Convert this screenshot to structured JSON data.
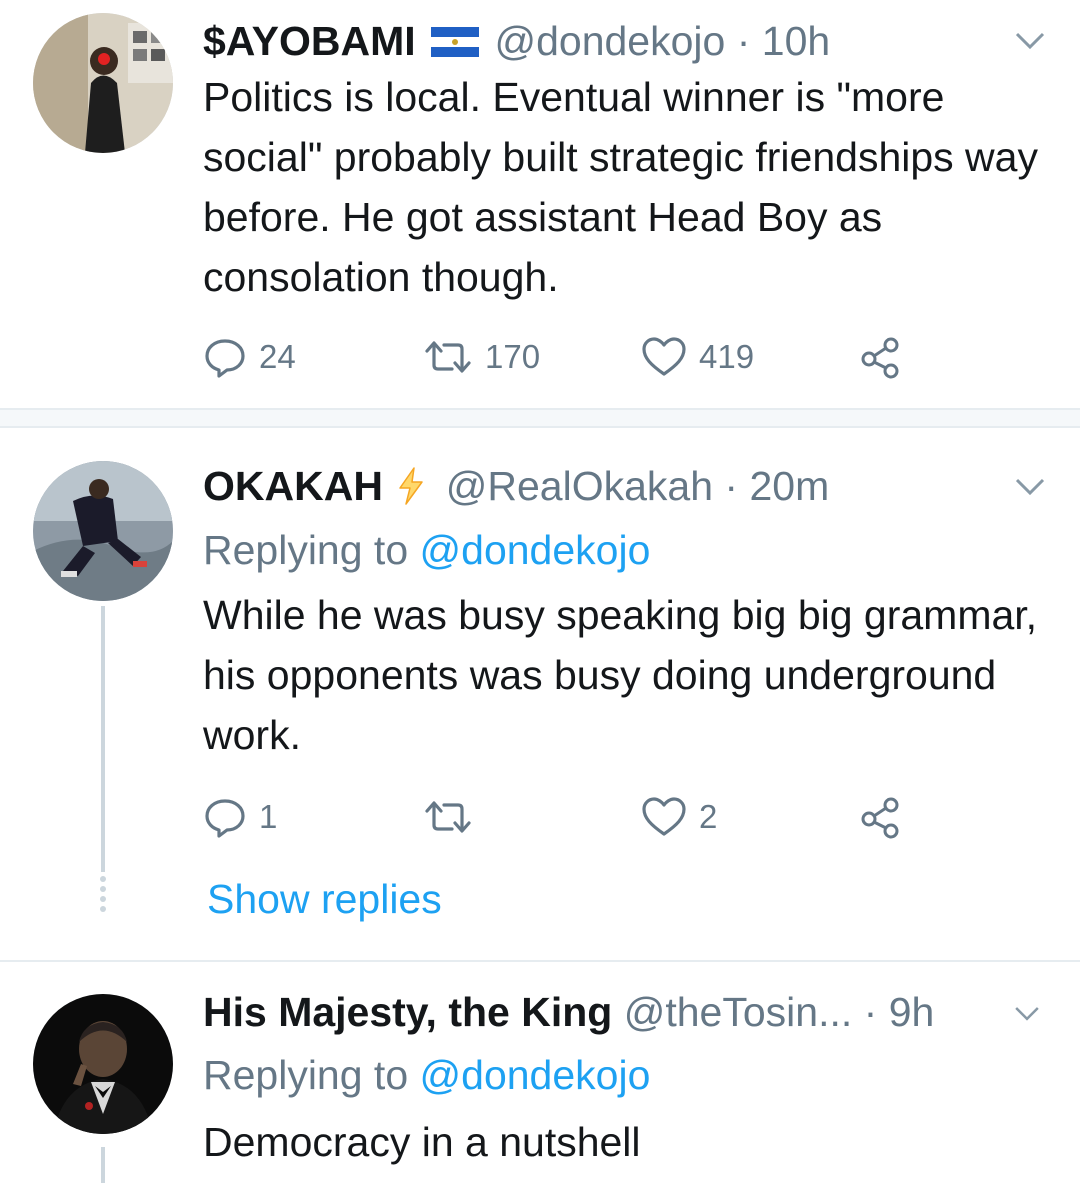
{
  "tweets": [
    {
      "name": "$AYOBAMI",
      "handle": "@dondekojo",
      "separator": "·",
      "time": "10h",
      "text": "Politics is local. Eventual winner is \"more social\" probably built strategic friendships way before. He got assistant Head Boy as consolation though.",
      "replies": "24",
      "retweets": "170",
      "likes": "419",
      "flag_icon": "el-salvador-flag-icon",
      "avatar_icon": "person-in-hallway-avatar"
    },
    {
      "name": "OKAKAH",
      "handle": "@RealOkakah",
      "separator": "·",
      "time": "20m",
      "reply_prefix": "Replying to",
      "reply_to": "@dondekojo",
      "text": "While he was busy speaking big big grammar, his opponents was busy doing underground work.",
      "replies": "1",
      "retweets": "",
      "likes": "2",
      "show_replies": "Show replies",
      "badge_icon": "lightning-bolt-icon",
      "avatar_icon": "person-sitting-on-rock-avatar"
    },
    {
      "name": "His Majesty, the King",
      "handle": "@theTosin...",
      "separator": "·",
      "time": "9h",
      "reply_prefix": "Replying to",
      "reply_to": "@dondekojo",
      "text": "Democracy in a nutshell",
      "avatar_icon": "godfather-portrait-avatar"
    }
  ],
  "colors": {
    "text": "#14171a",
    "secondary": "#657786",
    "link": "#1da1f2",
    "divider": "#e6ecf0"
  }
}
